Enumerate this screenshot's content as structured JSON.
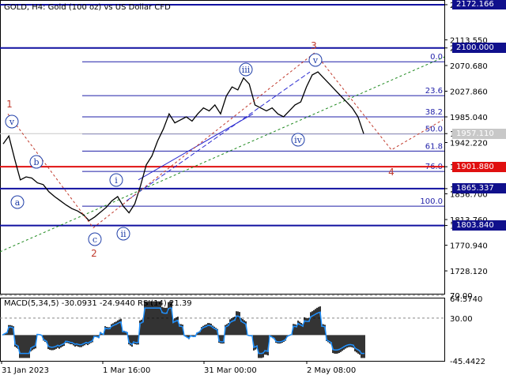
{
  "header": {
    "title": "GOLD, H4:  Gold (100 oz) vs US Dollar CFD"
  },
  "macd_panel": {
    "title": "MACD(5,34,5) -30.0931 -24.9440 RSI(14) 21.39",
    "axis_labels": [
      "64.5740",
      "70.00",
      "30.00",
      "-45.4422"
    ]
  },
  "price_axis": {
    "tick_labels": [
      "2172.166",
      "2113.550",
      "2100.000",
      "2070.680",
      "2027.860",
      "1985.040",
      "1957.110",
      "1942.220",
      "1901.880",
      "1865.337",
      "1856.700",
      "1813.760",
      "1803.840",
      "1770.940",
      "1728.120"
    ]
  },
  "time_axis": {
    "labels": [
      "31 Jan 2023",
      "1 Mar 16:00",
      "31 Mar 00:00",
      "2 May 08:00"
    ]
  },
  "levels": [
    {
      "price": 2172.166,
      "label": "2172.166",
      "color": "#1010a0",
      "badge_bg": "#10108c"
    },
    {
      "price": 2100.0,
      "label": "2100.000",
      "color": "#1010a0",
      "badge_bg": "#10108c"
    },
    {
      "price": 1901.88,
      "label": "1901.880",
      "color": "#e01010",
      "badge_bg": "#e01010"
    },
    {
      "price": 1865.337,
      "label": "1865.337",
      "color": "#1010a0",
      "badge_bg": "#10108c"
    },
    {
      "price": 1803.84,
      "label": "1803.840",
      "color": "#1010a0",
      "badge_bg": "#10108c"
    }
  ],
  "current_price": {
    "price": 1957.11,
    "label": "1957.110",
    "badge_bg": "#c8c8c8"
  },
  "fibonacci": [
    {
      "label": "0.0",
      "price": 2077.0
    },
    {
      "label": "23.6",
      "price": 2020.5
    },
    {
      "label": "38.2",
      "price": 1985.0
    },
    {
      "label": "50.0",
      "price": 1956.5
    },
    {
      "label": "61.8",
      "price": 1928.0
    },
    {
      "label": "76.0",
      "price": 1894.0
    },
    {
      "label": "100.0",
      "price": 1836.0
    }
  ],
  "wave_labels_major": [
    {
      "text": "1"
    },
    {
      "text": "2"
    },
    {
      "text": "3"
    },
    {
      "text": "4"
    }
  ],
  "wave_labels_minor": [
    {
      "text": "v"
    },
    {
      "text": "a"
    },
    {
      "text": "b"
    },
    {
      "text": "c"
    },
    {
      "text": "i"
    },
    {
      "text": "ii"
    },
    {
      "text": "iii"
    },
    {
      "text": "iv"
    },
    {
      "text": "v"
    }
  ],
  "chart_data": {
    "type": "line",
    "title": "GOLD, H4:  Gold (100 oz) vs US Dollar CFD",
    "xlabel": "",
    "ylabel": "",
    "ylim": [
      1690,
      2180
    ],
    "grid": false,
    "x": [
      "31 Jan 2023",
      "1 Mar 16:00",
      "31 Mar 00:00",
      "2 May 08:00"
    ],
    "series": [
      {
        "values": [
          1940,
          1953,
          1915,
          1880,
          1885,
          1883,
          1875,
          1872,
          1860,
          1852,
          1845,
          1838,
          1832,
          1828,
          1822,
          1812,
          1818,
          1826,
          1834,
          1845,
          1852,
          1836,
          1825,
          1840,
          1870,
          1905,
          1920,
          1945,
          1965,
          1990,
          1975,
          1980,
          1985,
          1978,
          1990,
          2000,
          1995,
          2005,
          1990,
          2020,
          2035,
          2030,
          2050,
          2040,
          2005,
          2000,
          1995,
          2000,
          1990,
          1985,
          1995,
          2005,
          2010,
          2035,
          2055,
          2060,
          2050,
          2040,
          2030,
          2020,
          2010,
          2000,
          1985,
          1957
        ]
      }
    ],
    "macd": {
      "ylim": [
        -45.4422,
        64.574
      ],
      "reference_levels": [
        70.0,
        30.0
      ],
      "last_values": {
        "main": -30.0931,
        "signal": -24.944,
        "rsi": 21.39
      }
    }
  },
  "colors": {
    "background": "#ffffff",
    "price_line": "#000000",
    "support_resistance": "#1010a0",
    "key_level": "#e01010",
    "fib": "#1f1fa8",
    "wave_major": "#c0392b",
    "wave_minor": "#1f3ea8",
    "trend_dashed": "#1f8a1f",
    "macd_hist": "#000000",
    "macd_signal": "#1e90ff"
  }
}
